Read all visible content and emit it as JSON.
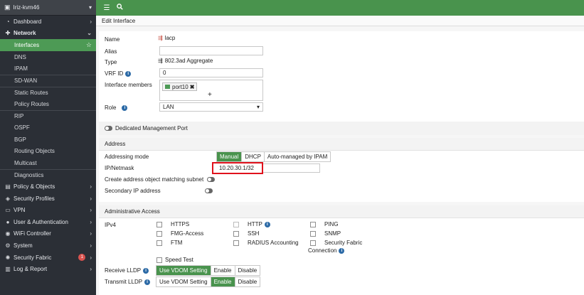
{
  "sidebar": {
    "device_name": "Iriz-kvm46",
    "items": [
      {
        "label": "Dashboard",
        "icon": "dashboard-icon"
      },
      {
        "label": "Network",
        "icon": "network-icon"
      },
      {
        "label": "Interfaces"
      },
      {
        "label": "DNS"
      },
      {
        "label": "IPAM"
      },
      {
        "label": "SD-WAN"
      },
      {
        "label": "Static Routes"
      },
      {
        "label": "Policy Routes"
      },
      {
        "label": "RIP"
      },
      {
        "label": "OSPF"
      },
      {
        "label": "BGP"
      },
      {
        "label": "Routing Objects"
      },
      {
        "label": "Multicast"
      },
      {
        "label": "Diagnostics"
      },
      {
        "label": "Policy & Objects",
        "icon": "policy-icon"
      },
      {
        "label": "Security Profiles",
        "icon": "security-profiles-icon"
      },
      {
        "label": "VPN",
        "icon": "vpn-icon"
      },
      {
        "label": "User & Authentication",
        "icon": "user-icon"
      },
      {
        "label": "WiFi Controller",
        "icon": "wifi-icon"
      },
      {
        "label": "System",
        "icon": "gear-icon"
      },
      {
        "label": "Security Fabric",
        "icon": "fabric-icon",
        "badge": "1"
      },
      {
        "label": "Log & Report",
        "icon": "chart-icon"
      }
    ]
  },
  "page": {
    "title": "Edit Interface"
  },
  "form": {
    "name_label": "Name",
    "name_value": "lacp",
    "alias_label": "Alias",
    "alias_value": "",
    "type_label": "Type",
    "type_value": "802.3ad Aggregate",
    "vrf_label": "VRF ID",
    "vrf_value": "0",
    "members_label": "Interface members",
    "member_tag": "port10",
    "add_glyph": "+",
    "role_label": "Role",
    "role_value": "LAN",
    "dedicated_mgmt": "Dedicated Management Port"
  },
  "address": {
    "section": "Address",
    "mode_label": "Addressing mode",
    "mode_options": [
      "Manual",
      "DHCP",
      "Auto-managed by IPAM"
    ],
    "ip_label": "IP/Netmask",
    "ip_value": "10.20.30.1/32",
    "create_obj_label": "Create address object matching subnet",
    "secondary_label": "Secondary IP address"
  },
  "admin": {
    "section": "Administrative Access",
    "ipv4_label": "IPv4",
    "col1": [
      "HTTPS",
      "FMG-Access",
      "FTM"
    ],
    "col2": [
      "HTTP",
      "SSH",
      "RADIUS Accounting"
    ],
    "col3": [
      "PING",
      "SNMP",
      "Security Fabric"
    ],
    "col3_extra": "Connection",
    "speed_test": "Speed Test",
    "receive_lldp_label": "Receive LLDP",
    "transmit_lldp_label": "Transmit LLDP",
    "lldp_options": [
      "Use VDOM Setting",
      "Enable",
      "Disable"
    ]
  },
  "colors": {
    "accent": "#49934d",
    "highlight": "#e0121c"
  }
}
